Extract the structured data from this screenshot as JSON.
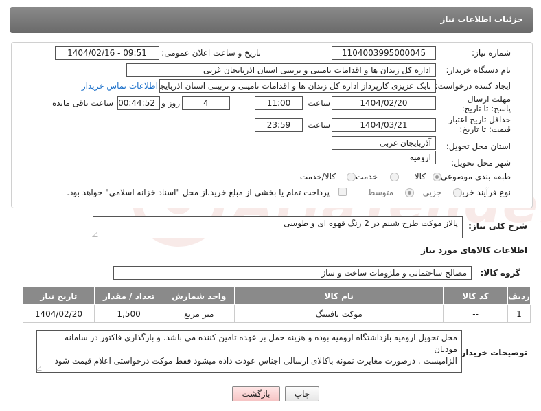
{
  "header": {
    "title": "جزئیات اطلاعات نیاز"
  },
  "form": {
    "need_number": {
      "label": "شماره نیاز:",
      "value": "1104003995000045"
    },
    "announce_datetime": {
      "label": "تاریخ و ساعت اعلان عمومی:",
      "value": "1404/02/16 - 09:51"
    },
    "buyer_org": {
      "label": "نام دستگاه خریدار:",
      "value": "اداره کل زندان ها و اقدامات تامینی و تربیتی استان اذربایجان غربی"
    },
    "requester": {
      "label": "ایجاد کننده درخواست:",
      "value": "بابک عزیزی کارپرداز اداره کل زندان ها و اقدامات تامینی و تربیتی استان اذربایجان غربی",
      "contact_link": "اطلاعات تماس خریدار"
    },
    "reply_deadline": {
      "label": "مهلت ارسال پاسخ: تا تاریخ:",
      "date": "1404/02/20",
      "time_label": "ساعت",
      "time": "11:00",
      "days": "4",
      "days_label": "روز و",
      "remaining": "00:44:52",
      "remaining_label": "ساعت باقی مانده"
    },
    "price_validity": {
      "label": "حداقل تاریخ اعتبار قیمت: تا تاریخ:",
      "date": "1404/03/21",
      "time_label": "ساعت",
      "time": "23:59"
    },
    "delivery_province": {
      "label": "استان محل تحویل:",
      "value": "آذربایجان غربی"
    },
    "delivery_city": {
      "label": "شهر محل تحویل:",
      "value": "ارومیه"
    },
    "category": {
      "label": "طبقه بندی موضوعی:",
      "options": [
        "کالا",
        "خدمت",
        "کالا/خدمت"
      ],
      "selected": "کالا"
    },
    "purchase_type": {
      "label": "نوع فرآیند خرید :",
      "options": [
        "جزیی",
        "متوسط"
      ],
      "selected": "متوسط",
      "payment_note": "پرداخت تمام یا بخشی از مبلغ خرید،از محل \"اسناد خزانه اسلامی\" خواهد بود."
    }
  },
  "description": {
    "label": "شرح کلی نیاز:",
    "value": "پالاز موکت طرح شبنم  در 2 رنگ قهوه ای و طوسی"
  },
  "goods_info": {
    "title": "اطلاعات کالاهای مورد نیاز",
    "group_label": "گروه کالا:",
    "group_value": "مصالح ساختمانی و ملزومات ساخت و ساز",
    "columns": [
      "ردیف",
      "کد کالا",
      "نام کالا",
      "واحد شمارش",
      "تعداد / مقدار",
      "تاریخ نیاز"
    ],
    "rows": [
      {
        "index": "1",
        "code": "--",
        "name": "موکت تافتینگ",
        "unit": "متر مربع",
        "qty": "1,500",
        "date": "1404/02/20"
      }
    ]
  },
  "buyer_notes": {
    "label": "توضیحات خریدار:",
    "line1": "محل تحویل ارومیه بازداشتگاه ارومیه بوده و  هزینه حمل بر عهده تامین کننده می باشد. و بارگذاری فاکتور در سامانه مودیان",
    "line2": "الزامیست . درصورت مغایرت نمونه باکالای ارسالی اجناس عودت داده میشود فقط موکت درخواستی اعلام قیمت شود"
  },
  "buttons": {
    "print": "چاپ",
    "back": "بازگشت"
  },
  "watermark": {
    "text": "AriaTender.neT"
  },
  "colors": {
    "header_bg": "#7a7a7a",
    "link": "#1a6fc9",
    "back_button": "#f6c4c4"
  }
}
